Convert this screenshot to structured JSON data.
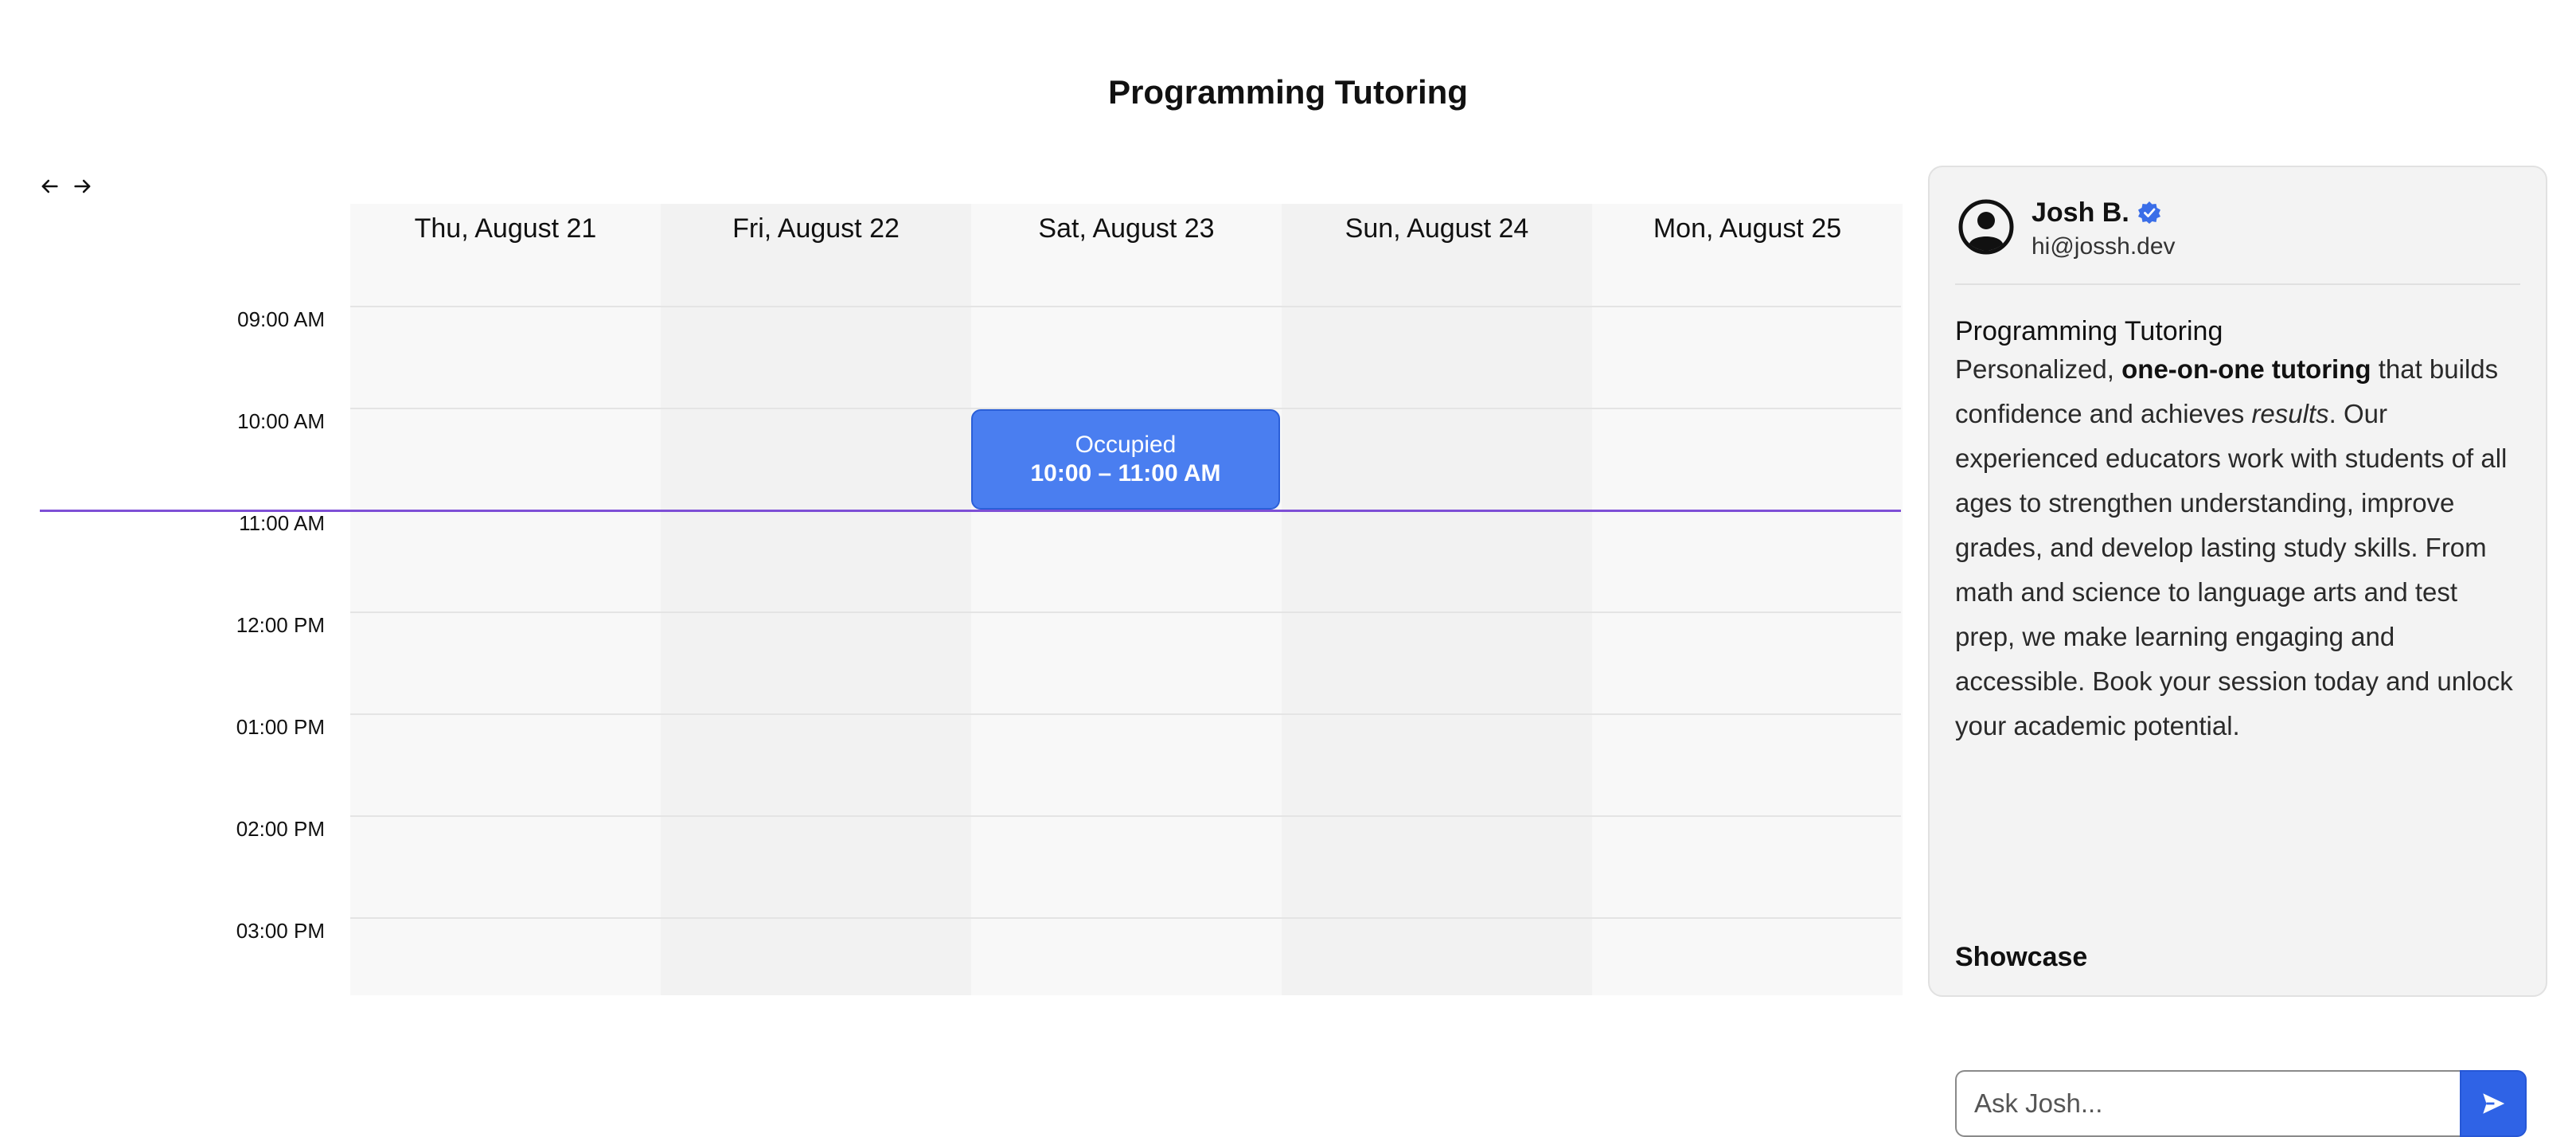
{
  "page": {
    "title": "Programming Tutoring"
  },
  "nav": {
    "prev_icon": "arrow-left-icon",
    "next_icon": "arrow-right-icon"
  },
  "calendar": {
    "days": [
      {
        "label": "Thu, August 21"
      },
      {
        "label": "Fri, August 22"
      },
      {
        "label": "Sat, August 23"
      },
      {
        "label": "Sun, August 24"
      },
      {
        "label": "Mon, August 25"
      }
    ],
    "times": [
      "09:00 AM",
      "10:00 AM",
      "11:00 AM",
      "12:00 PM",
      "01:00 PM",
      "02:00 PM",
      "03:00 PM"
    ],
    "event": {
      "title": "Occupied",
      "time": "10:00 – 11:00 AM",
      "day": "Sat, August 23",
      "color": "#4a7ef0"
    },
    "now_line_color": "#7e4fd6"
  },
  "host": {
    "name": "Josh B.",
    "email": "hi@jossh.dev",
    "avatar_icon": "user-circle-icon",
    "verified_icon": "verified-badge-icon"
  },
  "service": {
    "title": "Programming Tutoring",
    "desc_1": "Personalized, ",
    "desc_2": "one-on-one tutoring",
    "desc_3": " that builds confidence and achieves ",
    "desc_4": "results",
    "desc_5": ". Our experienced educators work with students of all ages to strengthen understanding, improve grades, and develop lasting study skills. From math and science to language arts and test prep, we make learning engaging and accessible. Book your session today and unlock your academic potential."
  },
  "showcase": {
    "label": "Showcase"
  },
  "chat": {
    "placeholder": "Ask Josh...",
    "send_icon": "send-icon",
    "accent": "#2f63e6"
  }
}
